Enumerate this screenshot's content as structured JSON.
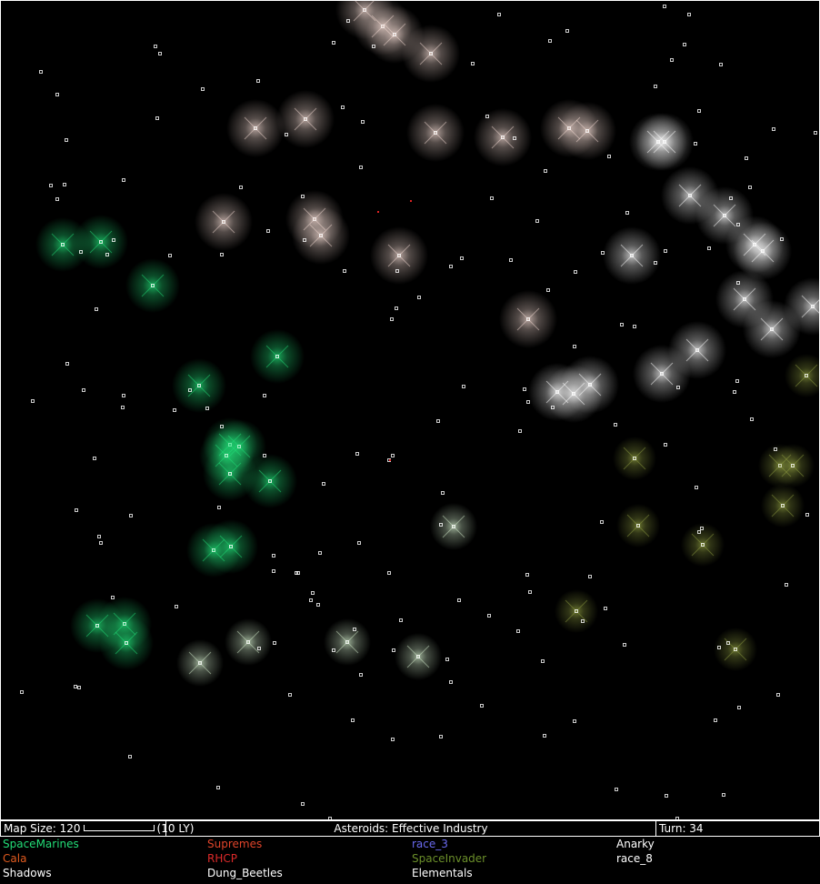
{
  "status_bar": {
    "map_size_label": "Map Size: 120",
    "scale_label": "(10 LY)",
    "hint": "Asteroids: Effective Industry",
    "turn_label": "Turn: 34"
  },
  "legend": [
    {
      "name": "SpaceMarines",
      "color": "#22dd77"
    },
    {
      "name": "Supremes",
      "color": "#e0442a"
    },
    {
      "name": "race_3",
      "color": "#6a6af0"
    },
    {
      "name": "Anarky",
      "color": "#ffffff"
    },
    {
      "name": "Cala",
      "color": "#e05a1e"
    },
    {
      "name": "RHCP",
      "color": "#dd2a2a"
    },
    {
      "name": "SpaceInvader",
      "color": "#6b8f2a"
    },
    {
      "name": "race_8",
      "color": "#ffffff"
    },
    {
      "name": "Shadows",
      "color": "#ffffff"
    },
    {
      "name": "Dung_Beetles",
      "color": "#ffffff"
    },
    {
      "name": "Elementals",
      "color": "#ffffff"
    }
  ],
  "colors": {
    "green_race": "#22dd77",
    "white_race": "#ffffff",
    "pink_race": "#f0d8d0",
    "olive_race": "#8c9a40",
    "pale_green_race": "#cfe8c8",
    "star": "#ffffff",
    "enemy_marker": "#dd2222"
  }
}
